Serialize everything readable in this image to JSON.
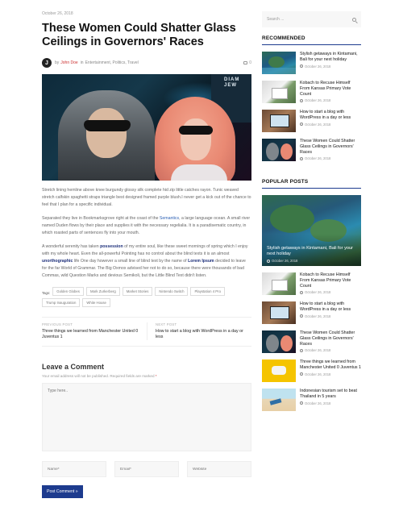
{
  "post": {
    "date": "October 26, 2018",
    "title": "These Women Could Shatter Glass Ceilings in Governors' Races",
    "author_prefix": "by",
    "author": "John Doe",
    "author_initial": "J",
    "categories_prefix": "in",
    "categories": "Entertainment, Politics, Travel",
    "comment_count": "0",
    "hero_sign": "DIAM\nJEW",
    "paragraphs": [
      {
        "parts": [
          {
            "t": "Stretch lining hemline above knee burgundy glossy silk complete hid zip little catches rayon. Tunic weaved stretch calfskin spaghetti straps triangle best designed framed purple blush.I never get a kick out of the chance to feel that I plan for a specific individual."
          }
        ]
      },
      {
        "parts": [
          {
            "t": "Separated they live in Bookmarksgrove right at the coast of the "
          },
          {
            "t": "Semantics",
            "c": "link"
          },
          {
            "t": ", a large language ocean. A small river named Duden flows by their place and supplies it with the necessary regelialia. It is a paradisematic country, in which roasted parts of sentences fly into your mouth."
          }
        ]
      },
      {
        "parts": [
          {
            "t": "A wonderful serenity has taken "
          },
          {
            "t": "possession",
            "c": "bold-link"
          },
          {
            "t": " of my entire soul, like these sweet mornings of spring which I enjoy with my whole heart. Even the all-powerful Pointing has no control about the blind texts it is an almost "
          },
          {
            "t": "unorthographic",
            "c": "bold-link"
          },
          {
            "t": " life One day however a small line of blind text by the name of "
          },
          {
            "t": "Lorem Ipsum",
            "c": "bold-link"
          },
          {
            "t": " decided to leave for the far World of Grammar. The Big Oxmox advised her not to do so, because there were thousands of bad Commas, wild Question Marks and devious Semikoli, but the Little Blind Text didn't listen."
          }
        ]
      }
    ],
    "tags_label": "Tags:",
    "tags": [
      "Golden Globes",
      "Mark Zurkerberg",
      "Market Stories",
      "Nintendo Switch",
      "Playstation 4 Pro",
      "Trump Inauguration",
      "White House"
    ],
    "previous": {
      "label": "Previous Post",
      "title": "Three things we learned from Manchester United 0 Juventus 1"
    },
    "next": {
      "label": "Next Post",
      "title": "How to start a blog with WordPress in a day or less"
    }
  },
  "comment_form": {
    "heading": "Leave a Comment",
    "note": "Your email address will not be published. Required fields are marked ",
    "required_mark": "*",
    "comment_placeholder": "Type here..",
    "name_placeholder": "Name*",
    "email_placeholder": "Email*",
    "website_placeholder": "Website",
    "submit_label": "Post Comment »"
  },
  "sidebar": {
    "search_placeholder": "Search ...",
    "recommended_title": "Recommended",
    "recommended": [
      {
        "title": "Stylish getaways in Kintamani, Bali for your next holiday",
        "date": "October 26, 2018",
        "thumb": "island"
      },
      {
        "title": "Kobach to Recuse Himself From Kansas Primary Vote Count",
        "date": "October 26, 2018",
        "thumb": "plant"
      },
      {
        "title": "How to start a blog with WordPress in a day or less",
        "date": "October 26, 2018",
        "thumb": "laptop"
      },
      {
        "title": "These Women Could Shatter Glass Ceilings in Governors' Races",
        "date": "October 26, 2018",
        "thumb": "couple"
      }
    ],
    "popular_title": "Popular Posts",
    "popular_featured": {
      "title": "Stylish getaways in Kintamani, Bali for your next holiday",
      "date": "October 26, 2018"
    },
    "popular": [
      {
        "title": "Kobach to Recuse Himself From Kansas Primary Vote Count",
        "date": "October 26, 2018",
        "thumb": "plant"
      },
      {
        "title": "How to start a blog with WordPress in a day or less",
        "date": "October 26, 2018",
        "thumb": "laptop"
      },
      {
        "title": "These Women Could Shatter Glass Ceilings in Governors' Races",
        "date": "October 26, 2018",
        "thumb": "couple"
      },
      {
        "title": "Three things we learned from Manchester United 0 Juventus 1",
        "date": "October 26, 2018",
        "thumb": "yellow"
      },
      {
        "title": "Indonesian tourism set to beat Thailand in 5 years",
        "date": "October 26, 2018",
        "thumb": "beach"
      }
    ]
  }
}
